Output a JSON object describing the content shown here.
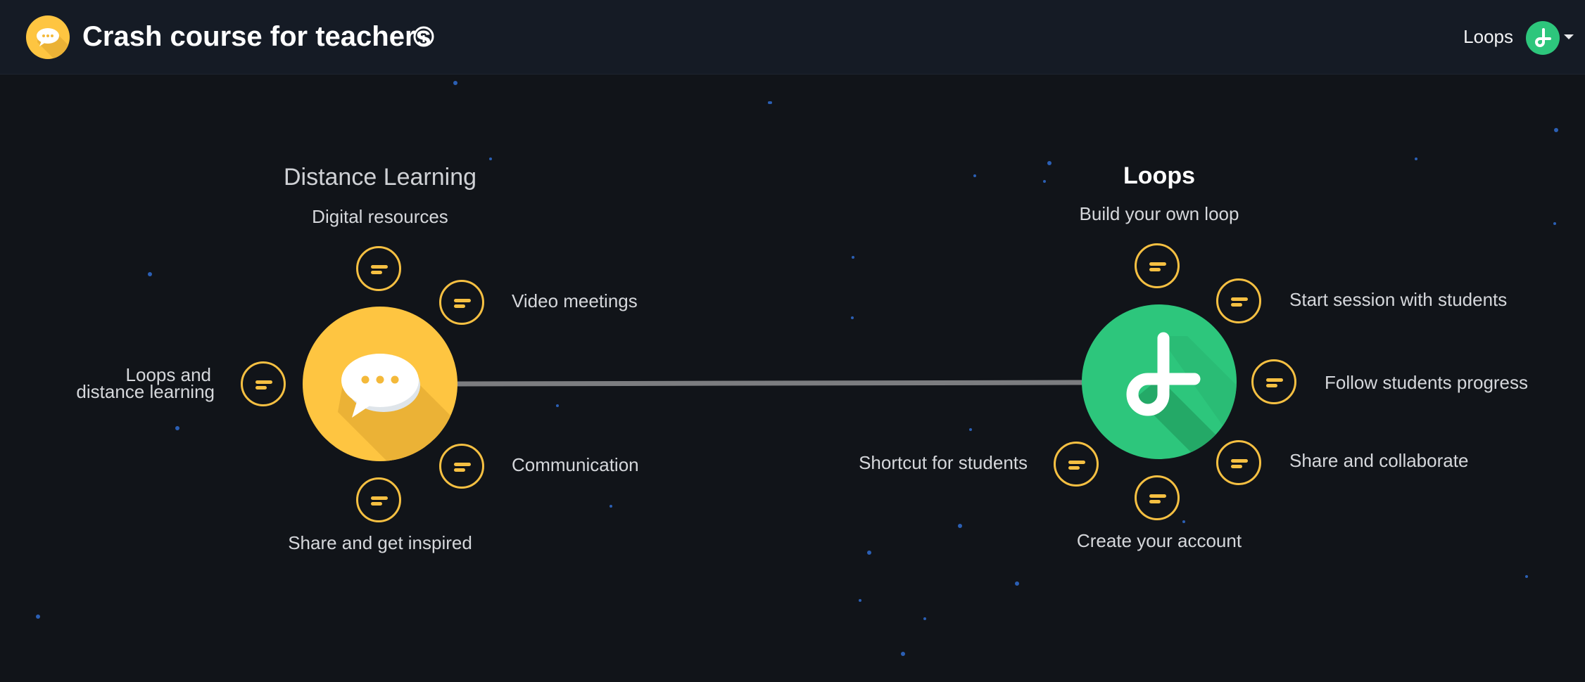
{
  "header": {
    "title": "Crash course for teachers",
    "nav_link": "Loops",
    "icons": {
      "logo": "speech-bubble-logo",
      "info": "info-icon",
      "avatar": "loops-avatar",
      "menu": "caret-down-icon"
    }
  },
  "map": {
    "left_hub": {
      "title": "Distance Learning",
      "color": "#fec541",
      "icon": "speech-bubble-icon",
      "topics": {
        "top": "Digital resources",
        "top_right": "Video meetings",
        "left_line1": "Loops and",
        "left_line2": "distance learning",
        "bottom_right": "Communication",
        "bottom": "Share and get inspired"
      }
    },
    "right_hub": {
      "title": "Loops",
      "color": "#2dc67c",
      "icon": "loops-icon",
      "topics": {
        "top": "Build your own loop",
        "top_right": "Start session with students",
        "right": "Follow students progress",
        "bottom_right": "Share and collaborate",
        "bottom": "Create your account",
        "bottom_left": "Shortcut for students"
      }
    },
    "node_icon": "text-lines-icon",
    "node_color": "#f6c042"
  }
}
